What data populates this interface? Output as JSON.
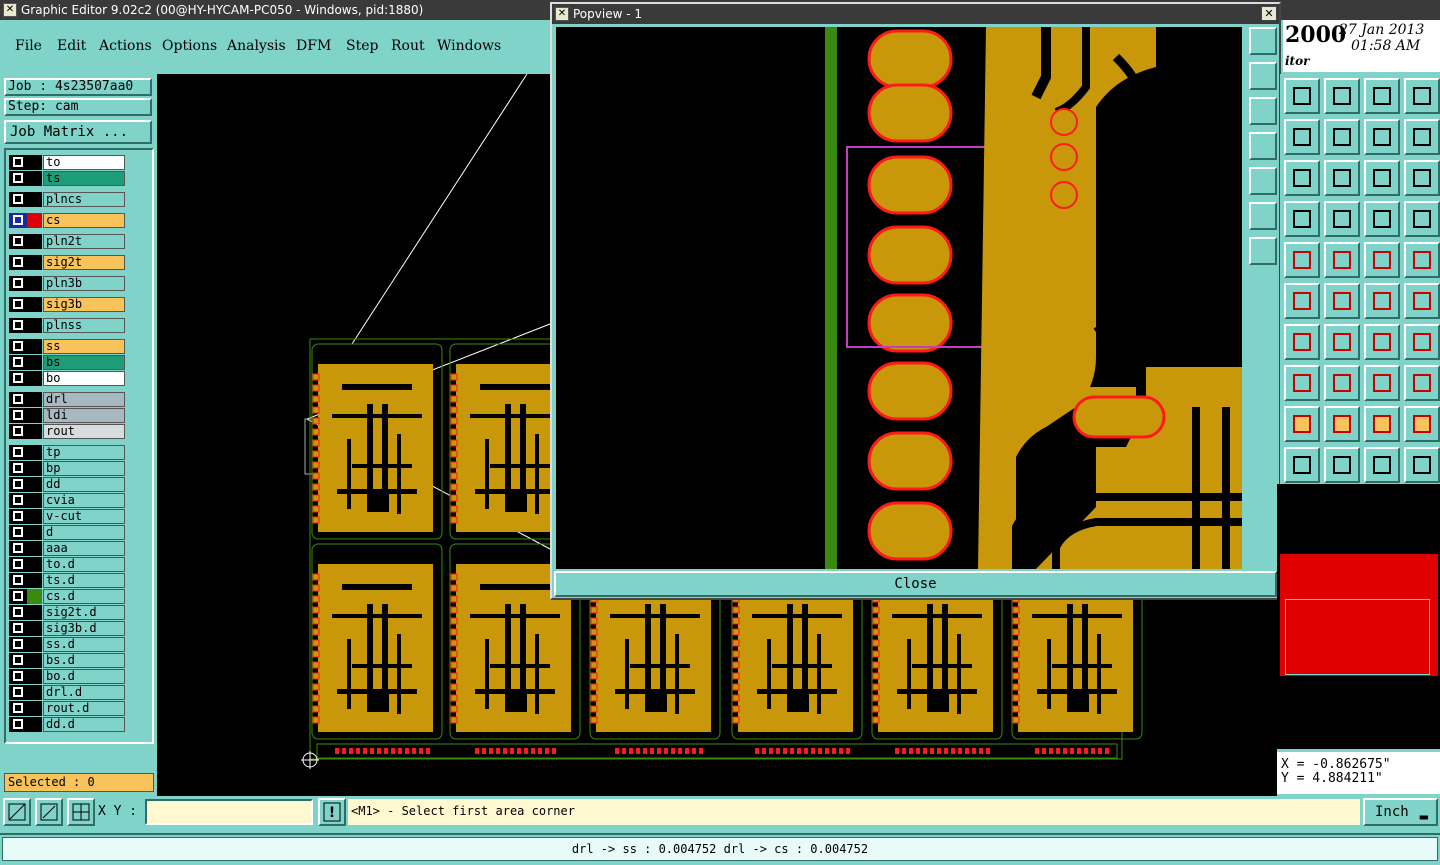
{
  "window": {
    "title": "Graphic Editor 9.02c2 (00@HY-HYCAM-PC050 - Windows, pid:1880)"
  },
  "menu": [
    "File",
    "Edit",
    "Actions",
    "Options",
    "Analysis",
    "DFM",
    "Step",
    "Rout",
    "Windows"
  ],
  "job": {
    "job_label": "Job : 4s23507aa0",
    "step_label": "Step: cam",
    "matrix_button": "Job Matrix ..."
  },
  "layers": [
    {
      "name": "to",
      "color": "#ffffff",
      "swatch": "#000000"
    },
    {
      "name": "ts",
      "color": "#1f9c78",
      "swatch": "#000000"
    },
    {
      "name": "plncs",
      "color": "#7fd3c9",
      "swatch": "#000000"
    },
    {
      "name": "cs",
      "color": "#f7c35a",
      "swatch": "#e00000",
      "active": true
    },
    {
      "name": "pln2t",
      "color": "#7fd3c9",
      "swatch": "#000000"
    },
    {
      "name": "sig2t",
      "color": "#f7c35a",
      "swatch": "#000000"
    },
    {
      "name": "pln3b",
      "color": "#7fd3c9",
      "swatch": "#000000"
    },
    {
      "name": "sig3b",
      "color": "#f7c35a",
      "swatch": "#000000"
    },
    {
      "name": "plnss",
      "color": "#7fd3c9",
      "swatch": "#000000"
    },
    {
      "name": "ss",
      "color": "#f7c35a",
      "swatch": "#000000"
    },
    {
      "name": "bs",
      "color": "#1f9c78",
      "swatch": "#000000"
    },
    {
      "name": "bo",
      "color": "#ffffff",
      "swatch": "#000000"
    },
    {
      "name": "drl",
      "color": "#a8b8c0",
      "swatch": "#000000"
    },
    {
      "name": "ldi",
      "color": "#a8b8c0",
      "swatch": "#000000"
    },
    {
      "name": "rout",
      "color": "#d8dcdc",
      "swatch": "#000000"
    },
    {
      "name": "tp",
      "color": "#7fd3c9",
      "swatch": "#000000"
    },
    {
      "name": "bp",
      "color": "#7fd3c9",
      "swatch": "#000000"
    },
    {
      "name": "dd",
      "color": "#7fd3c9",
      "swatch": "#000000"
    },
    {
      "name": "cvia",
      "color": "#7fd3c9",
      "swatch": "#000000"
    },
    {
      "name": "v-cut",
      "color": "#7fd3c9",
      "swatch": "#000000"
    },
    {
      "name": "d",
      "color": "#7fd3c9",
      "swatch": "#000000"
    },
    {
      "name": "aaa",
      "color": "#7fd3c9",
      "swatch": "#000000"
    },
    {
      "name": "to.d",
      "color": "#7fd3c9",
      "swatch": "#000000"
    },
    {
      "name": "ts.d",
      "color": "#7fd3c9",
      "swatch": "#000000"
    },
    {
      "name": "cs.d",
      "color": "#7fd3c9",
      "swatch": "#3a8a10"
    },
    {
      "name": "sig2t.d",
      "color": "#7fd3c9",
      "swatch": "#000000"
    },
    {
      "name": "sig3b.d",
      "color": "#7fd3c9",
      "swatch": "#000000"
    },
    {
      "name": "ss.d",
      "color": "#7fd3c9",
      "swatch": "#000000"
    },
    {
      "name": "bs.d",
      "color": "#7fd3c9",
      "swatch": "#000000"
    },
    {
      "name": "bo.d",
      "color": "#7fd3c9",
      "swatch": "#000000"
    },
    {
      "name": "drl.d",
      "color": "#7fd3c9",
      "swatch": "#000000"
    },
    {
      "name": "rout.d",
      "color": "#7fd3c9",
      "swatch": "#000000"
    },
    {
      "name": "dd.d",
      "color": "#7fd3c9",
      "swatch": "#000000"
    }
  ],
  "selected": "Selected : 0",
  "popview": {
    "title": "Popview - 1",
    "close_label": "Close"
  },
  "clock": {
    "brand": "2000",
    "date": "27 Jan 2013",
    "time": "01:58 AM",
    "subtitle": "itor"
  },
  "coords": {
    "x": "X = -0.862675\"",
    "y": "Y = 4.884211\""
  },
  "bottom": {
    "xy_label": "X Y :",
    "prompt": "<M1> - Select first area corner",
    "unit": "Inch"
  },
  "status": "drl -> ss : 0.004752    drl -> cs : 0.004752",
  "colors": {
    "copper": "#c8980a",
    "pad_edge": "#ff1a1a",
    "trace_green": "#3a8a10",
    "teal": "#7fd3c9",
    "highlight": "#c040c0"
  }
}
